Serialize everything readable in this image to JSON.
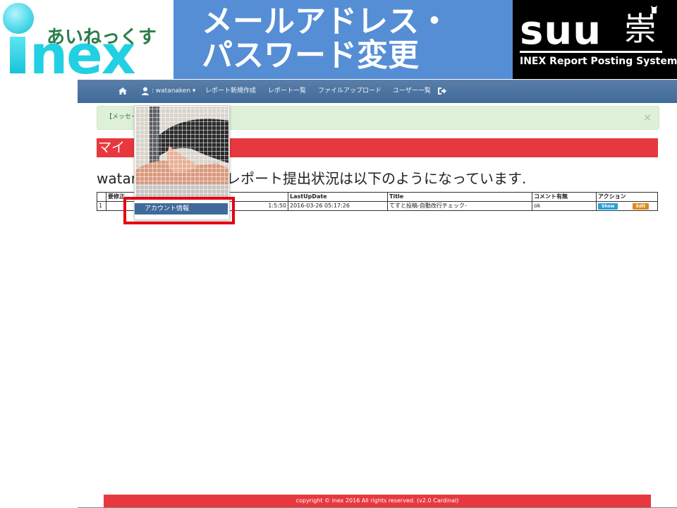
{
  "slide": {
    "logo": {
      "kana": "あいねっくす",
      "wordmark": "nex"
    },
    "title_line1": "メールアドレス・",
    "title_line2": "パスワード変更",
    "suu": {
      "word": "suu",
      "kanji": "崇",
      "subtitle": "INEX Report Posting System"
    }
  },
  "app": {
    "nav": {
      "home_icon": "home-icon",
      "user_label": ": watanaken",
      "items": [
        "レポート新規作成",
        "レポート一覧",
        "ファイルアップロード",
        "ユーザー一覧"
      ],
      "logout_icon": "sign-out-icon"
    },
    "alert": {
      "text": "【メッセー",
      "close": "×"
    },
    "banner": {
      "text": "マイ"
    },
    "status": {
      "left": "watan",
      "right": "レポート提出状況は以下のようになっています."
    },
    "table": {
      "headers": [
        "",
        "要修正",
        "",
        "LastUpDate",
        "Title",
        "コメント有無",
        "アクション"
      ],
      "rows": [
        {
          "id": "1",
          "fix": "",
          "created": "1:5:50",
          "last_update": "2016-03-26 05:17:26",
          "title": "てすと投稿-自動改行チェック-",
          "comment": "ok",
          "show": "Show",
          "edit": "Edit"
        }
      ]
    },
    "dropdown": {
      "account_item": "アカウント情報"
    },
    "footer": "copyright © inex 2016 All rights reserved. (v2.0 Cardinal)"
  },
  "colors": {
    "nav": "#4a72a0",
    "title_bg": "#558ed5",
    "banner": "#e8383f",
    "highlight": "#e50012"
  }
}
